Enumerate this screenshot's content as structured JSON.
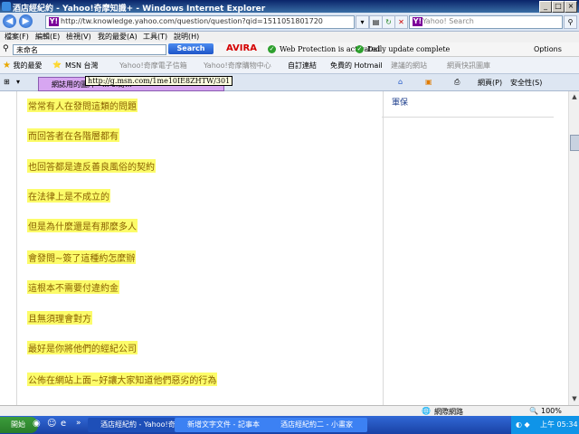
{
  "window": {
    "title": "酒店經紀約 - Yahoo!奇摩知識+ - Windows Internet Explorer",
    "controls": {
      "minimize": "_",
      "maximize": "□",
      "close": "×"
    }
  },
  "address_bar": {
    "url": "http://tw.knowledge.yahoo.com/question/question?qid=1511051801720",
    "search_placeholder": "Yahoo! Search"
  },
  "menu": [
    "檔案(F)",
    "編輯(E)",
    "檢視(V)",
    "我的最愛(A)",
    "工具(T)",
    "說明(H)"
  ],
  "yahoo_toolbar": {
    "search_value": "未命名",
    "search_button": "Search",
    "brand": "AVIRA",
    "web_protection": "Web Protection is activated",
    "update": "Daily update complete",
    "options": "Options"
  },
  "favorites": {
    "label": "我的最愛",
    "items": [
      {
        "label": "MSN 台灣",
        "dim": false
      },
      {
        "label": "Yahoo!奇摩電子信箱",
        "dim": true
      },
      {
        "label": "Yahoo!奇摩購物中心",
        "dim": true
      },
      {
        "label": "自訂連結",
        "dim": false
      },
      {
        "label": "免費的 Hotmail",
        "dim": false
      },
      {
        "label": "建議的網站",
        "dim": true
      },
      {
        "label": "網頁快訊圖庫",
        "dim": true
      }
    ]
  },
  "tab": {
    "label": "網誌用的圖片 - ... ol奇...",
    "close": "×"
  },
  "tooltip": "http://g.msn.com/1me10IE8ZHTW/301",
  "command_bar": {
    "page": "網頁(P)",
    "safety": "安全性(S)"
  },
  "content": {
    "lines": [
      "常常有人在發問這類的問題",
      "而回答者在各階層都有",
      "也回答都是違反善良風俗的契約",
      "在法律上是不成立的",
      "但是為什麼還是有那麼多人",
      "會發問~簽了這種約怎麼辦",
      "這根本不需要付違約金",
      "且無須理會對方",
      "最好是你將他們的經紀公司",
      "公佈在網站上面~好讓大家知道他們惡劣的行為"
    ],
    "side_link": "軍保"
  },
  "status_bar": {
    "zone": "網際網路",
    "zoom": "100%"
  },
  "taskbar": {
    "start": "開始",
    "tasks": [
      {
        "label": "酒店經紀約 - Yahoo!奇...",
        "active": true
      },
      {
        "label": "新增文字文件 - 記事本",
        "active": false
      },
      {
        "label": "酒店經紀約二 - 小畫家",
        "active": false
      }
    ],
    "clock": "上午 05:34"
  },
  "colors": {
    "highlight": "#fcfc6a",
    "highlight_text": "#8a6000",
    "tab": "#d7a6f1",
    "taskbar": "#2456c4"
  }
}
